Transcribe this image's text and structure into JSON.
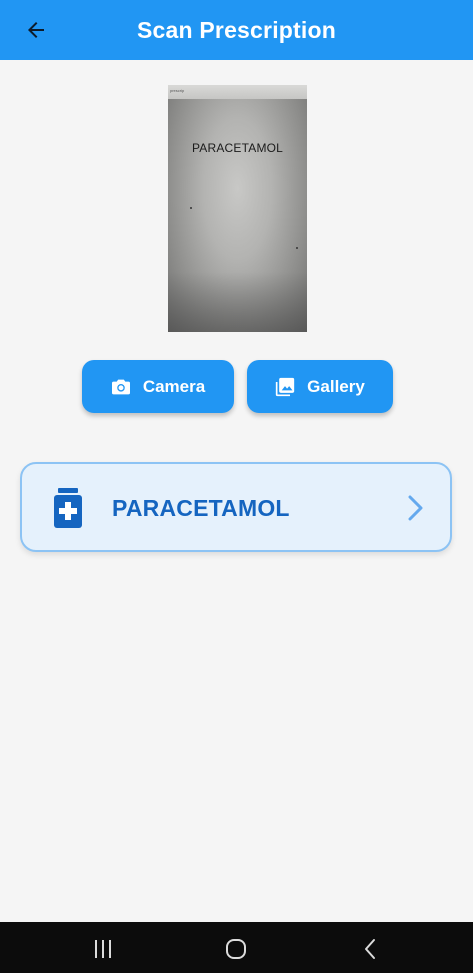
{
  "app_bar": {
    "title": "Scan Prescription",
    "back_icon": "arrow-left-icon",
    "background": "#2196f3"
  },
  "preview": {
    "detected_text": "PARACETAMOL",
    "header_text": "prescrip"
  },
  "buttons": {
    "camera": {
      "label": "Camera",
      "icon": "camera-icon"
    },
    "gallery": {
      "label": "Gallery",
      "icon": "image-icon"
    }
  },
  "result": {
    "medicine_name": "PARACETAMOL",
    "icon": "medicine-bottle-icon",
    "chevron_icon": "chevron-right-icon",
    "accent": "#1565c0"
  },
  "system_nav": {
    "recents_icon": "recents-icon",
    "home_icon": "home-icon",
    "back_icon": "back-chevron-icon"
  }
}
